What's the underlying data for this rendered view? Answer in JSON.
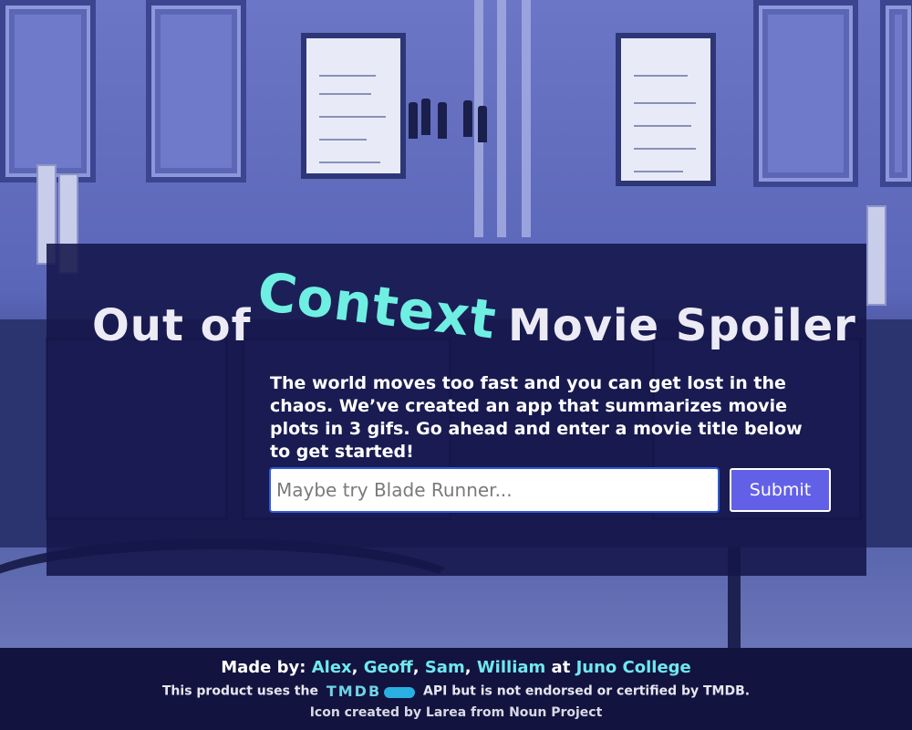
{
  "title": {
    "part1": "Out of",
    "part2": "Context",
    "part3": "Movie Spoiler"
  },
  "intro_text": "The world moves too fast and you can get lost in the chaos. We’ve created an app that summarizes movie plots in 3 gifs. Go ahead and enter a movie title below to get started!",
  "search": {
    "placeholder": "Maybe try Blade Runner...",
    "value": "",
    "submit_label": "Submit"
  },
  "footer": {
    "made_by_label": "Made by:",
    "authors": [
      "Alex",
      "Geoff",
      "Sam",
      "William"
    ],
    "at_label": "at",
    "organization": "Juno College",
    "tmdb_prefix": "This product uses the",
    "tmdb_logo": "TMDB",
    "tmdb_suffix": "API but is not endorsed or certified by TMDB.",
    "icon_credit": "Icon created by Larea from Noun Project"
  },
  "colors": {
    "card_bg": "#14164a",
    "accent_teal": "#6fefe2",
    "button": "#6360e8",
    "footer_bg": "#12133f"
  }
}
